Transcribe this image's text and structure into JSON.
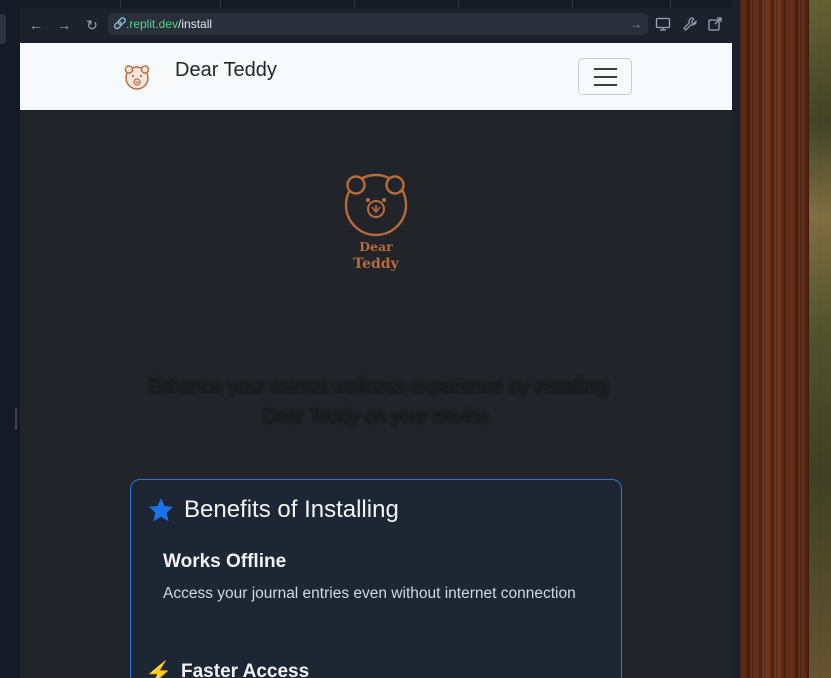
{
  "browser": {
    "url_host": ".replit.dev",
    "url_path": "/install",
    "icons": [
      "back-arrow-icon",
      "forward-arrow-icon",
      "reload-icon",
      "link-icon",
      "go-arrow-icon",
      "monitor-icon",
      "wrench-icon",
      "external-link-icon"
    ]
  },
  "navbar": {
    "brand": "Dear Teddy",
    "toggler_icon": "hamburger-menu-icon"
  },
  "hero": {
    "logo_line1": "Dear",
    "logo_line2": "Teddy",
    "tagline": "Enhance your mental wellness experience by installing Dear Teddy on your device."
  },
  "benefits": {
    "title": "Benefits of Installing",
    "title_icon": "star-icon",
    "items": [
      {
        "title": "Works Offline",
        "description": "Access your journal entries even without internet connection"
      },
      {
        "title": "Faster Access",
        "icon": "lightning-icon"
      }
    ]
  },
  "colors": {
    "brand_brown": "#b86a3a",
    "accent_blue": "#2f72d6",
    "navbar_bg": "#f8f9fa",
    "page_bg": "#212428",
    "card_bg": "#1d2633"
  }
}
